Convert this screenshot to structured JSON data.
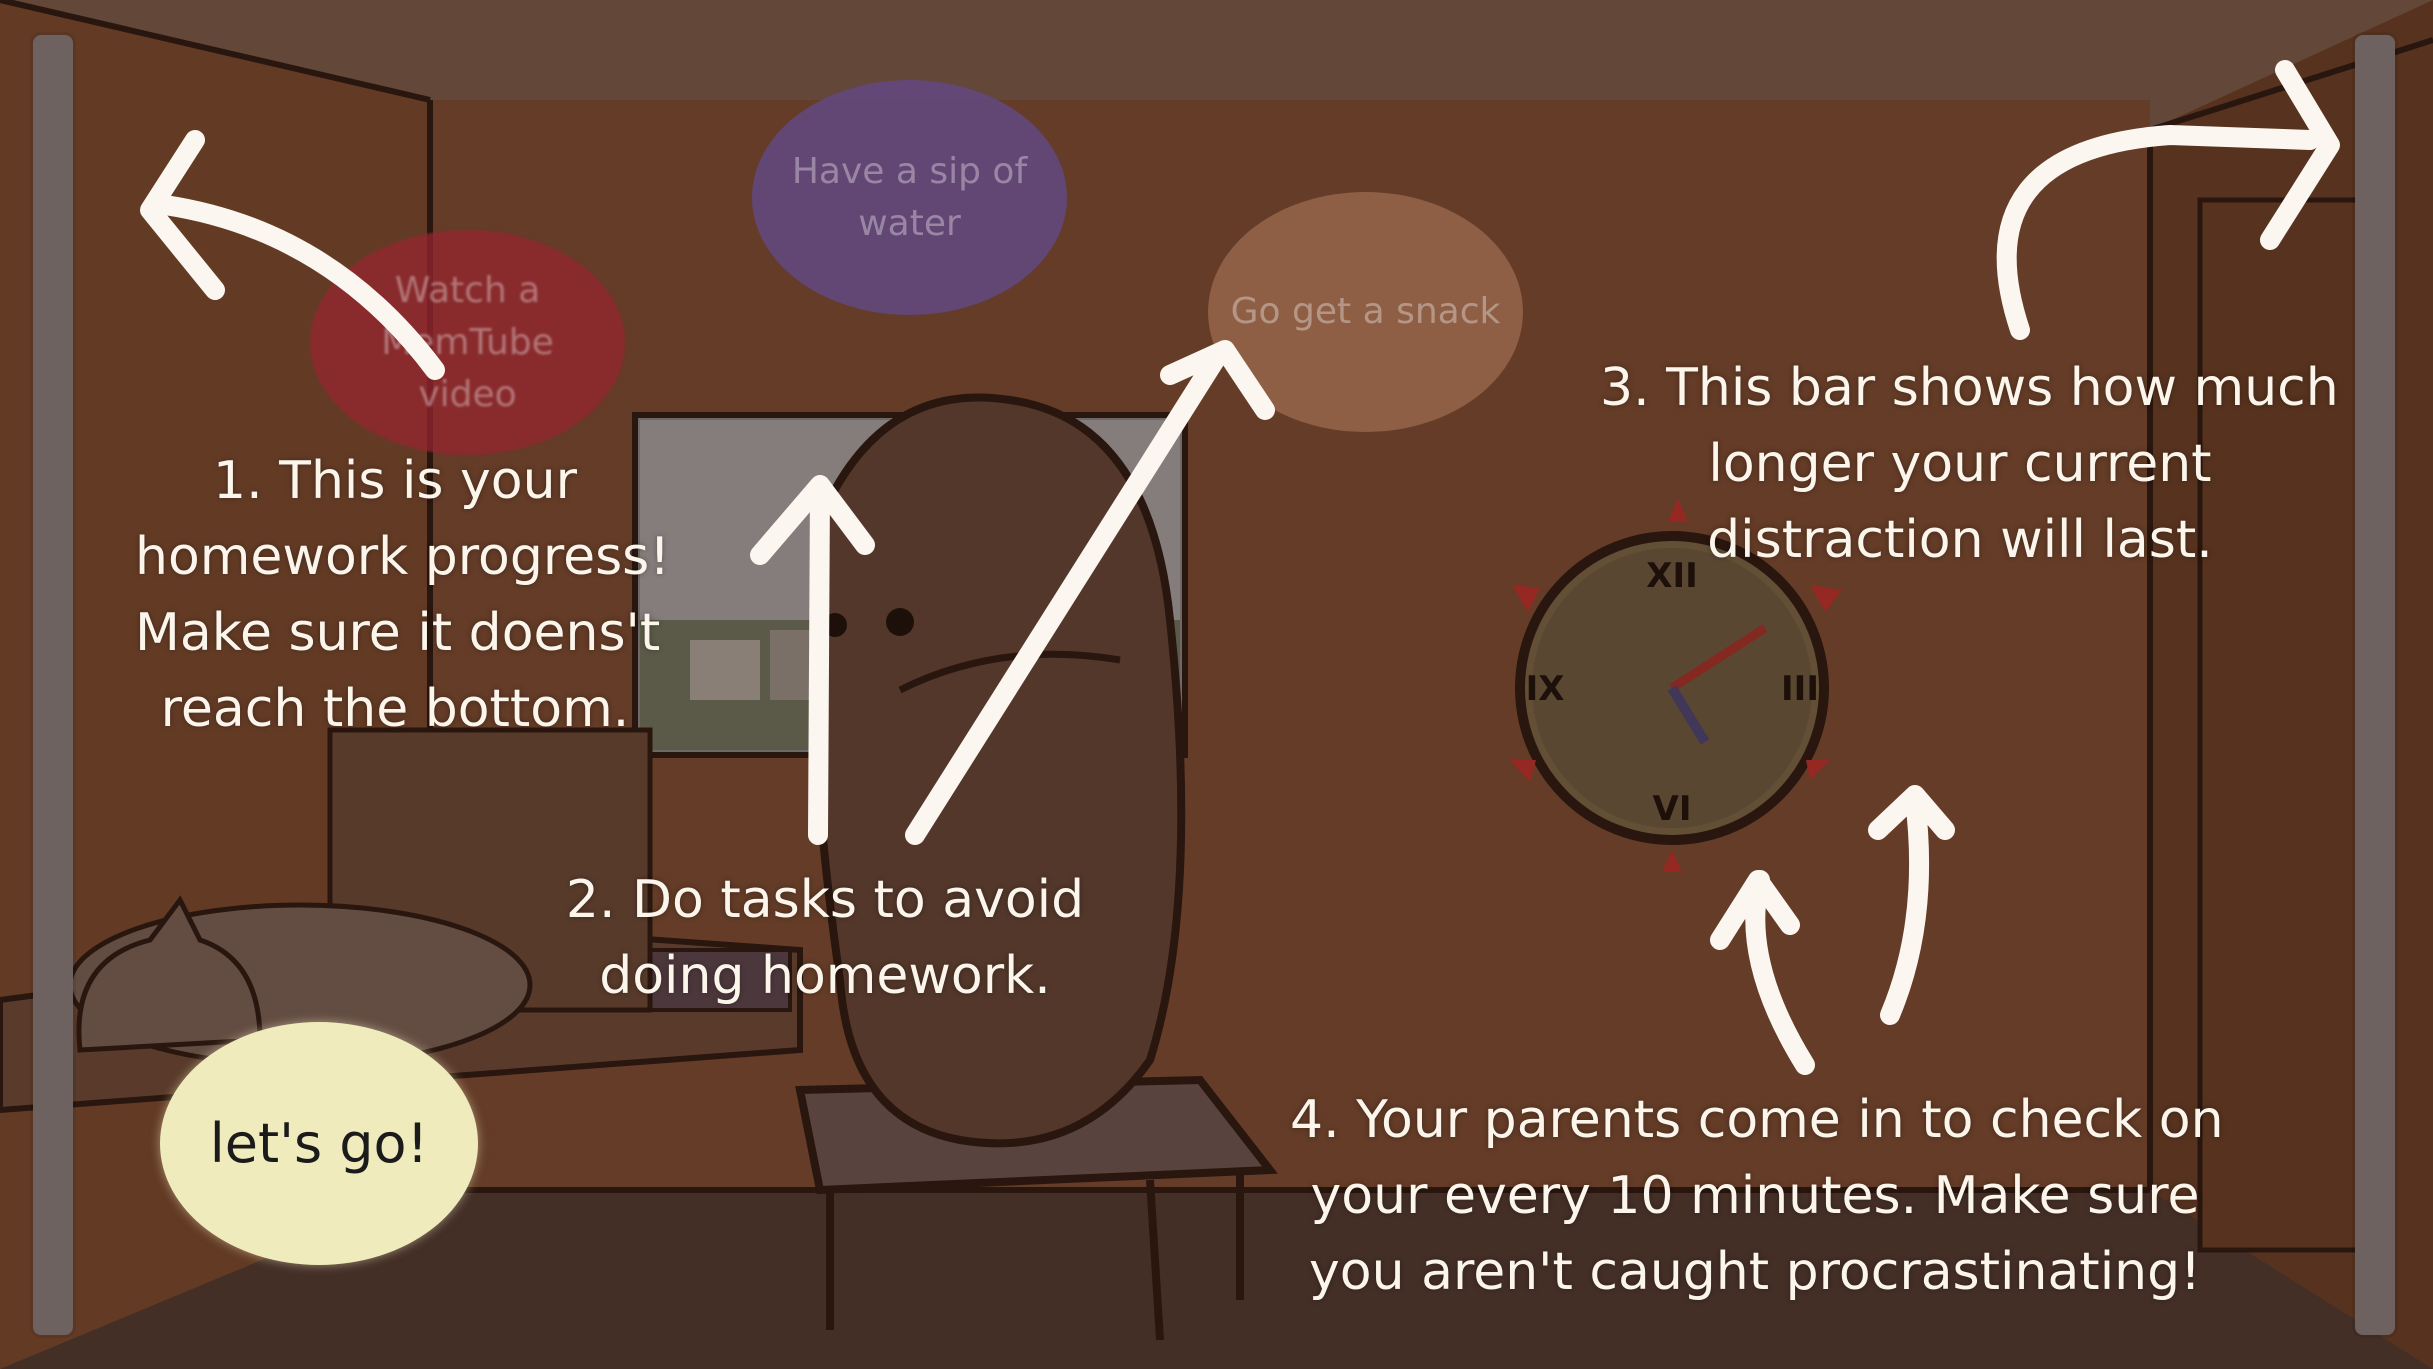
{
  "tasks": [
    {
      "lines": [
        "Watch a",
        "MemTube",
        "video"
      ],
      "color": "#96262f"
    },
    {
      "lines": [
        "Have a sip of",
        "water"
      ],
      "color": "#624882"
    },
    {
      "lines": [
        "Go get a snack"
      ],
      "color": "#b07c5e"
    }
  ],
  "tutorial": {
    "note1": [
      "1. This is your",
      "homework progress!",
      "Make sure it doens't",
      "reach the bottom."
    ],
    "note2": [
      "2. Do tasks to avoid",
      "doing homework."
    ],
    "note3": [
      "3. This bar shows how much",
      "longer your current",
      "distraction will last."
    ],
    "note4": [
      "4. Your parents come in to check on",
      "your every 10 minutes. Make sure",
      "you aren't caught procrastinating!"
    ]
  },
  "start_button": {
    "label": "let's go!",
    "color": "#f0ebbd"
  },
  "clock": {
    "numerals": [
      "XII",
      "III",
      "VI",
      "IX"
    ]
  },
  "homework_progress": {
    "fraction": 1.0
  },
  "distraction_remaining": {
    "fraction": 1.0
  }
}
